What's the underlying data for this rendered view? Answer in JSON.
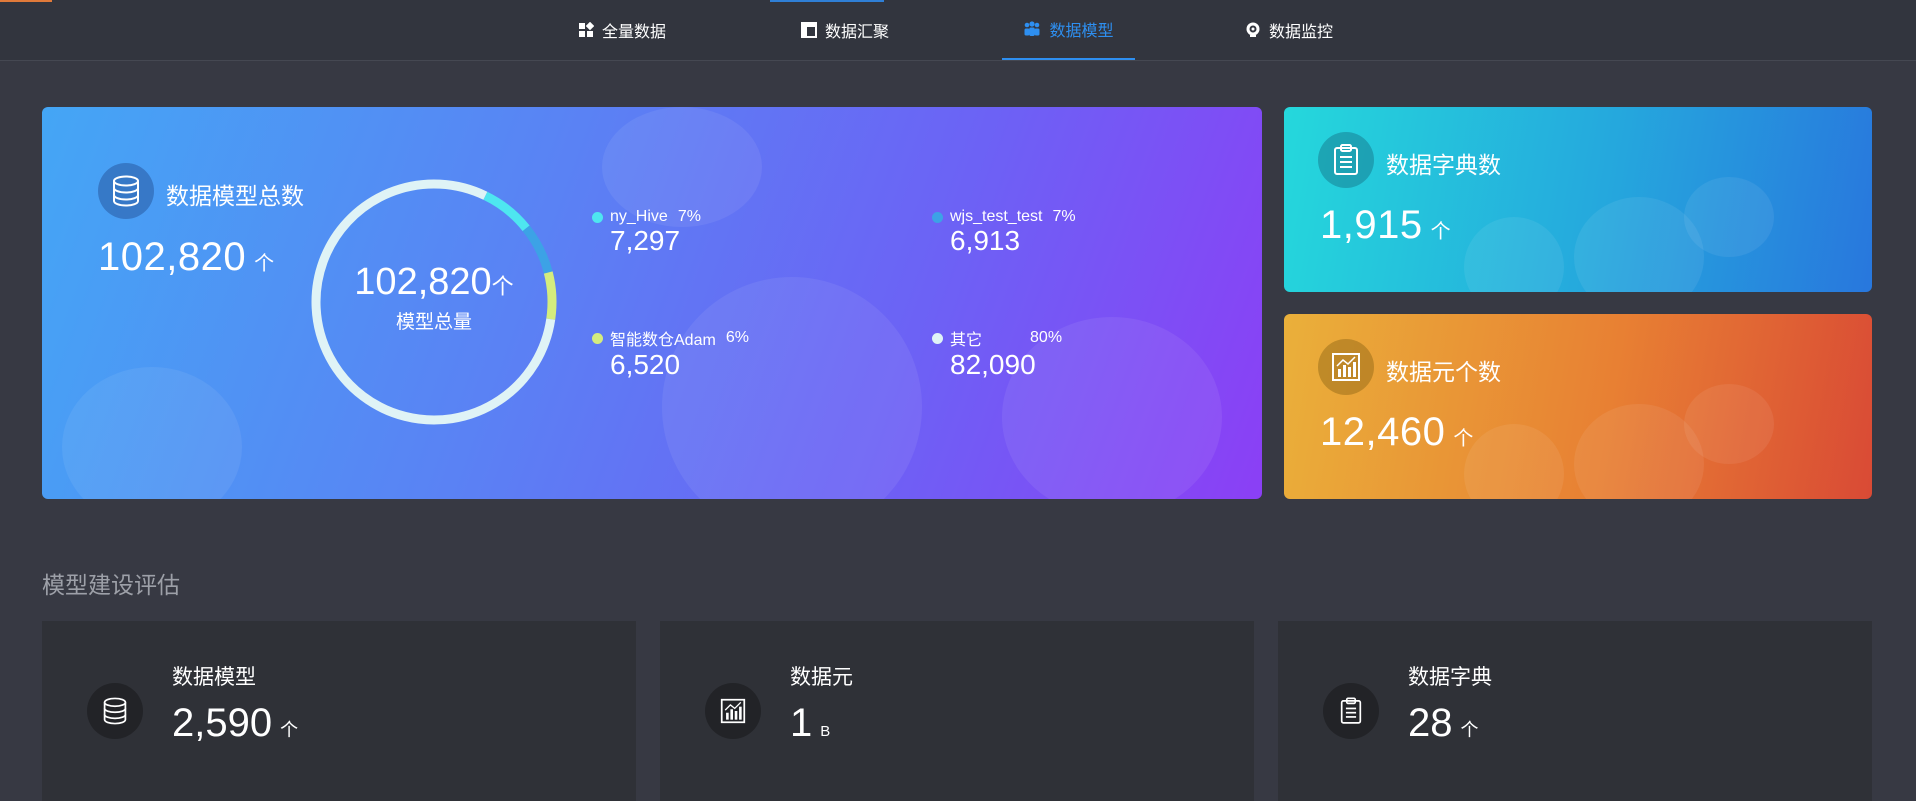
{
  "nav": {
    "tabs": [
      {
        "label": "全量数据",
        "icon": "grid-icon",
        "active": false
      },
      {
        "label": "数据汇聚",
        "icon": "layout-icon",
        "active": false
      },
      {
        "label": "数据模型",
        "icon": "people-icon",
        "active": true
      },
      {
        "label": "数据监控",
        "icon": "eye-icon",
        "active": false
      }
    ]
  },
  "summary": {
    "title": "数据模型总数",
    "total": "102,820",
    "unit": "个",
    "donut": {
      "center_value": "102,820",
      "center_unit": "个",
      "center_label": "模型总量"
    },
    "legend": [
      {
        "name": "ny_Hive",
        "pct": "7%",
        "value": "7,297",
        "color": "#4ee6f0"
      },
      {
        "name": "wjs_test_test",
        "pct": "7%",
        "value": "6,913",
        "color": "#3ca2e6"
      },
      {
        "name": "智能数仓Adam",
        "pct": "6%",
        "value": "6,520",
        "color": "#d4ec7e"
      },
      {
        "name": "其它",
        "pct": "80%",
        "value": "82,090",
        "color": "#dff3f6"
      }
    ]
  },
  "dict_card": {
    "title": "数据字典数",
    "value": "1,915",
    "unit": "个"
  },
  "elem_card": {
    "title": "数据元个数",
    "value": "12,460",
    "unit": "个"
  },
  "section": {
    "title": "模型建设评估"
  },
  "eval_cards": [
    {
      "title": "数据模型",
      "value": "2,590",
      "unit": "个",
      "icon": "database-icon"
    },
    {
      "title": "数据元",
      "value": "1",
      "unit": "B",
      "icon": "chart-icon"
    },
    {
      "title": "数据字典",
      "value": "28",
      "unit": "个",
      "icon": "clipboard-icon"
    }
  ],
  "chart_data": {
    "type": "pie",
    "categories": [
      "ny_Hive",
      "wjs_test_test",
      "智能数仓Adam",
      "其它"
    ],
    "values": [
      7297,
      6913,
      6520,
      82090
    ],
    "colors": [
      "#4ee6f0",
      "#3ca2e6",
      "#d4ec7e",
      "#dff3f6"
    ]
  }
}
